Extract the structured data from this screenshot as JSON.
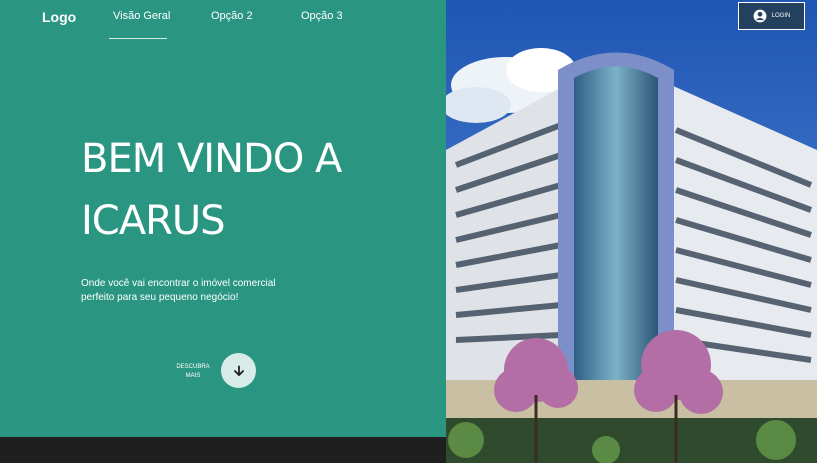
{
  "nav": {
    "logo": "Logo",
    "items": [
      {
        "label": "Visão Geral",
        "active": true
      },
      {
        "label": "Opção 2",
        "active": false
      },
      {
        "label": "Opção 3",
        "active": false
      }
    ]
  },
  "hero": {
    "heading_line1": "BEM VINDO A",
    "heading_line2": "ICARUS",
    "subtitle_line1": "Onde você vai encontrar o imóvel comercial",
    "subtitle_line2": "perfeito para seu pequeno negócio!",
    "discover_line1": "DESCUBRA",
    "discover_line2": "MAIS",
    "discover_icon": "arrow-down-icon"
  },
  "login": {
    "label": "LOGIN",
    "icon": "account-circle-icon"
  },
  "colors": {
    "panel": "#2a9682",
    "accent_light": "#d7ece8",
    "footer": "#1f1f1f"
  }
}
